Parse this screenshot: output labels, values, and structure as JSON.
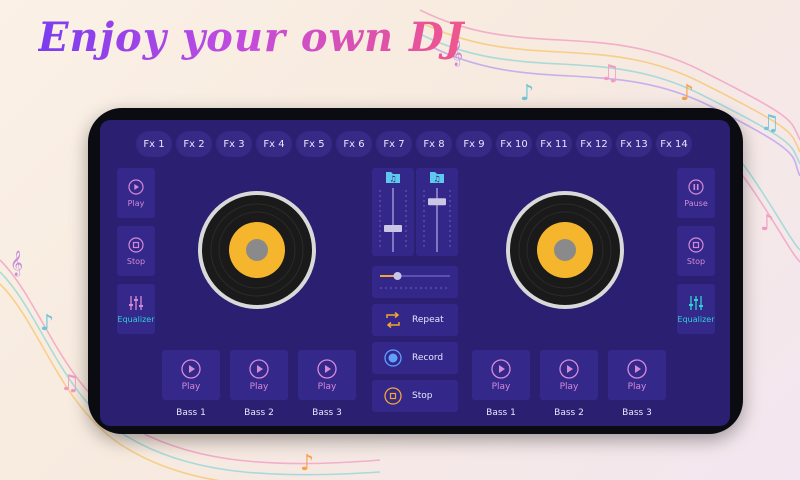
{
  "headline": "Enjoy your own DJ",
  "fx_buttons": [
    "Fx 1",
    "Fx 2",
    "Fx 3",
    "Fx 4",
    "Fx 5",
    "Fx 6",
    "Fx 7",
    "Fx 8",
    "Fx 9",
    "Fx 10",
    "Fx 11",
    "Fx 12",
    "Fx 13",
    "Fx 14"
  ],
  "left_deck": {
    "play": "Play",
    "stop": "Stop",
    "equalizer": "Equalizer"
  },
  "right_deck": {
    "pause": "Pause",
    "stop": "Stop",
    "equalizer": "Equalizer"
  },
  "center_controls": {
    "repeat": "Repeat",
    "record": "Record",
    "stop": "Stop"
  },
  "left_pads": [
    {
      "action": "Play",
      "name": "Bass 1"
    },
    {
      "action": "Play",
      "name": "Bass 2"
    },
    {
      "action": "Play",
      "name": "Bass 3"
    }
  ],
  "right_pads": [
    {
      "action": "Play",
      "name": "Bass 1"
    },
    {
      "action": "Play",
      "name": "Bass 2"
    },
    {
      "action": "Play",
      "name": "Bass 3"
    }
  ],
  "volume": {
    "left": 0.35,
    "right": 0.82
  },
  "crossfader_position": 0.25,
  "colors": {
    "left_accent": "#d58ad8",
    "right_accent": "#2fd1d8",
    "disc_label": "#f5b52c",
    "screen": "#2a1f70",
    "button": "#34288a"
  }
}
